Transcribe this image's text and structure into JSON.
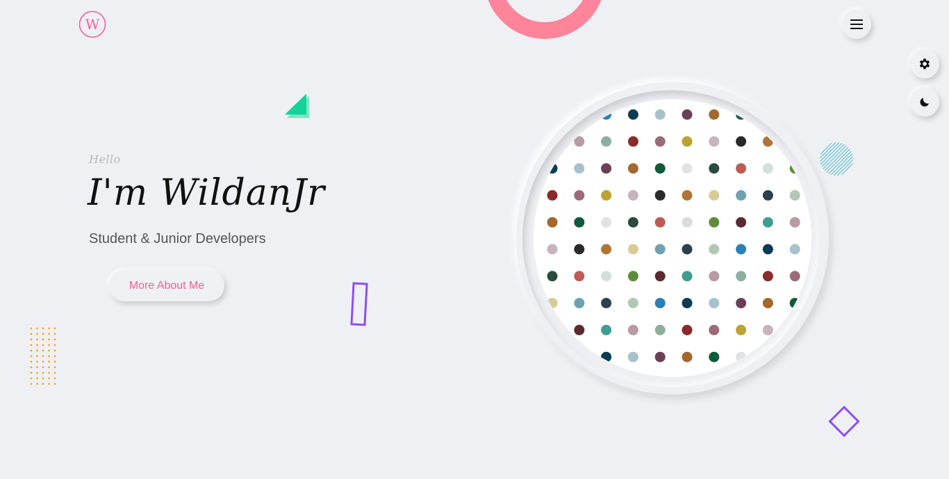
{
  "header": {
    "logo_letter": "W",
    "logo_icon": "w-logo-icon",
    "menu_icon": "hamburger-menu-icon"
  },
  "side_controls": {
    "settings_icon": "gear-icon",
    "theme_icon": "moon-icon"
  },
  "hero": {
    "greeting": "Hello",
    "name": "I'm WildanJr",
    "subtitle": "Student & Junior Developers",
    "cta_label": "More About Me"
  },
  "colors": {
    "background": "#eff0f4",
    "accent_pink": "#fe849a",
    "cta_text": "#f06292",
    "purple": "#8b4ff3",
    "orange_dots": "#f5a623",
    "green_triangle": "#12d39a",
    "hatch_teal": "#4fb9d0"
  },
  "profile_image": {
    "description_icon": "dot-pattern-image",
    "dot_palette": [
      "#2b3f4c",
      "#9a6b79",
      "#d2e0d8",
      "#a7c2cc",
      "#b17434",
      "#b79aa2",
      "#e2e2e4",
      "#b2c8b4",
      "#bda232",
      "#5f8c3a",
      "#6b3f56",
      "#d7cb96",
      "#8faf9e",
      "#2a4b3e",
      "#2a80b9",
      "#c9b3bd",
      "#5a2a30",
      "#a3672e",
      "#6ea2b1",
      "#8a2a2a",
      "#bd5c54",
      "#0c3c53",
      "#2a2a2a",
      "#3f9e8f",
      "#0f5a3a"
    ]
  }
}
